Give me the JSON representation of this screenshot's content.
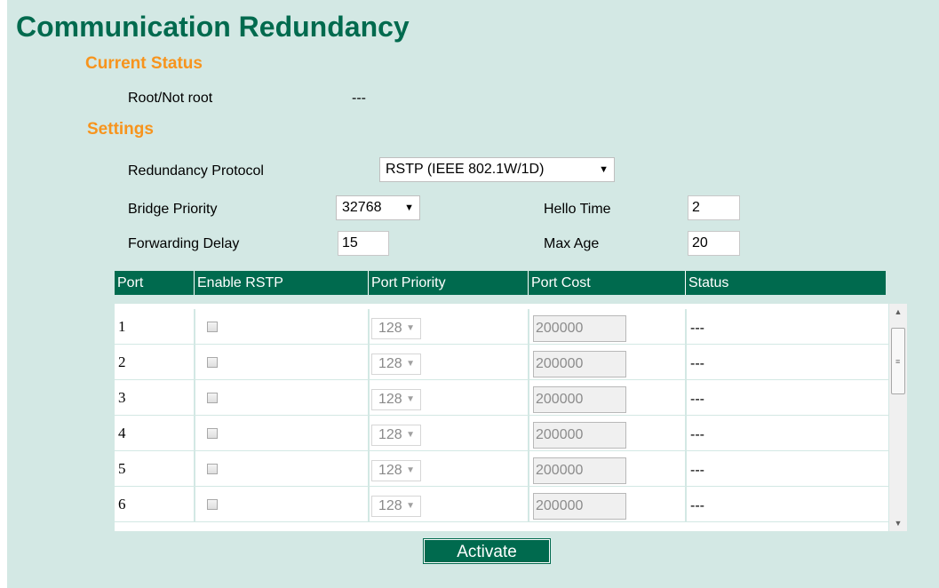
{
  "page": {
    "title": "Communication Redundancy"
  },
  "current_status": {
    "heading": "Current Status",
    "root_label": "Root/Not root",
    "root_value": "---"
  },
  "settings": {
    "heading": "Settings",
    "protocol_label": "Redundancy Protocol",
    "protocol_value": "RSTP (IEEE 802.1W/1D)",
    "bridge_priority_label": "Bridge Priority",
    "bridge_priority_value": "32768",
    "hello_time_label": "Hello Time",
    "hello_time_value": "2",
    "forwarding_delay_label": "Forwarding Delay",
    "forwarding_delay_value": "15",
    "max_age_label": "Max Age",
    "max_age_value": "20"
  },
  "table": {
    "headers": [
      "Port",
      "Enable RSTP",
      "Port Priority",
      "Port Cost",
      "Status"
    ],
    "rows": [
      {
        "port": "1",
        "enabled": false,
        "priority": "128",
        "cost": "200000",
        "status": "---"
      },
      {
        "port": "2",
        "enabled": false,
        "priority": "128",
        "cost": "200000",
        "status": "---"
      },
      {
        "port": "3",
        "enabled": false,
        "priority": "128",
        "cost": "200000",
        "status": "---"
      },
      {
        "port": "4",
        "enabled": false,
        "priority": "128",
        "cost": "200000",
        "status": "---"
      },
      {
        "port": "5",
        "enabled": false,
        "priority": "128",
        "cost": "200000",
        "status": "---"
      },
      {
        "port": "6",
        "enabled": false,
        "priority": "128",
        "cost": "200000",
        "status": "---"
      }
    ]
  },
  "buttons": {
    "activate_label": "Activate"
  },
  "icons": {
    "dropdown": "chevron-down-icon",
    "scroll_up": "scroll-up-icon",
    "scroll_down": "scroll-down-icon"
  },
  "colors": {
    "brand_green": "#006a4e",
    "heading_orange": "#f7941d",
    "panel_background": "#d3e8e4"
  }
}
